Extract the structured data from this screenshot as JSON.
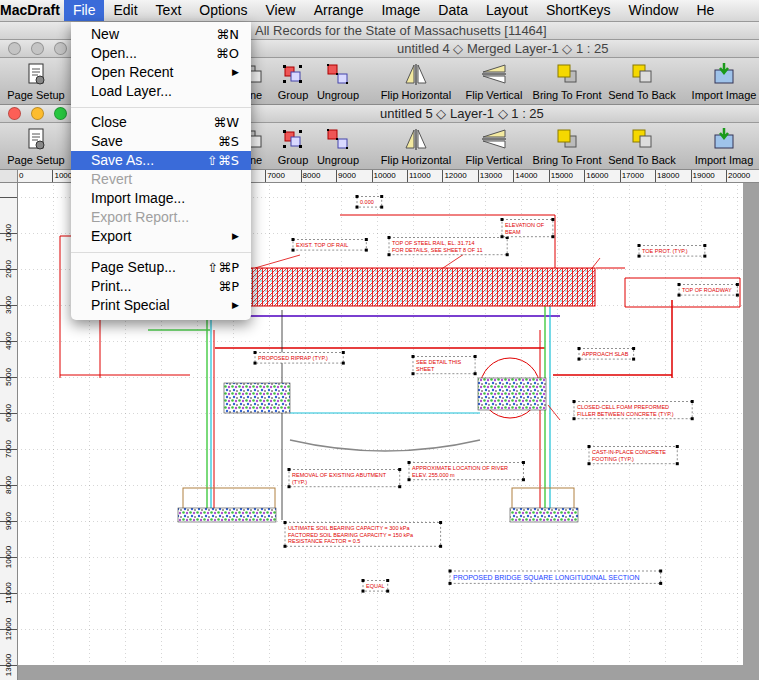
{
  "menubar": {
    "app": "MacDraft",
    "items": [
      {
        "label": "File",
        "selected": true
      },
      {
        "label": "Edit",
        "selected": false
      },
      {
        "label": "Text",
        "selected": false
      },
      {
        "label": "Options",
        "selected": false
      },
      {
        "label": "View",
        "selected": false
      },
      {
        "label": "Arrange",
        "selected": false
      },
      {
        "label": "Image",
        "selected": false
      },
      {
        "label": "Data",
        "selected": false
      },
      {
        "label": "Layout",
        "selected": false
      },
      {
        "label": "ShortKeys",
        "selected": false
      },
      {
        "label": "Window",
        "selected": false
      },
      {
        "label": "He",
        "selected": false
      }
    ]
  },
  "file_menu": [
    {
      "kind": "item",
      "label": "New",
      "shortcut": "⌘N",
      "selected": false,
      "disabled": false
    },
    {
      "kind": "item",
      "label": "Open...",
      "shortcut": "⌘O",
      "selected": false,
      "disabled": false
    },
    {
      "kind": "item",
      "label": "Open Recent",
      "shortcut": "▶",
      "selected": false,
      "disabled": false
    },
    {
      "kind": "item",
      "label": "Load Layer...",
      "shortcut": "",
      "selected": false,
      "disabled": false
    },
    {
      "kind": "separator"
    },
    {
      "kind": "item",
      "label": "Close",
      "shortcut": "⌘W",
      "selected": false,
      "disabled": false
    },
    {
      "kind": "item",
      "label": "Save",
      "shortcut": "⌘S",
      "selected": false,
      "disabled": false
    },
    {
      "kind": "item",
      "label": "Save As...",
      "shortcut": "⇧⌘S",
      "selected": true,
      "disabled": false
    },
    {
      "kind": "item",
      "label": "Revert",
      "shortcut": "",
      "selected": false,
      "disabled": true
    },
    {
      "kind": "item",
      "label": "Import Image...",
      "shortcut": "",
      "selected": false,
      "disabled": false
    },
    {
      "kind": "item",
      "label": "Export Report...",
      "shortcut": "",
      "selected": false,
      "disabled": true
    },
    {
      "kind": "item",
      "label": "Export",
      "shortcut": "▶",
      "selected": false,
      "disabled": false
    },
    {
      "kind": "separator"
    },
    {
      "kind": "item",
      "label": "Page Setup...",
      "shortcut": "⇧⌘P",
      "selected": false,
      "disabled": false
    },
    {
      "kind": "item",
      "label": "Print...",
      "shortcut": "⌘P",
      "selected": false,
      "disabled": false
    },
    {
      "kind": "item",
      "label": "Print Special",
      "shortcut": "▶",
      "selected": false,
      "disabled": false
    }
  ],
  "background_window": {
    "title": "All Records for the State of Massachusetts [11464]"
  },
  "windows": [
    {
      "title": "untitled 4 ◇ Merged Layer-1 ◇ 1 : 25",
      "active": false,
      "toolbar": [
        "Page Setup",
        "one",
        "Group",
        "Ungroup",
        "Flip Horizontal",
        "Flip Vertical",
        "Bring To Front",
        "Send To Back",
        "Import Image"
      ]
    },
    {
      "title": "untitled 5 ◇ Layer-1 ◇ 1 : 25",
      "active": true,
      "toolbar": [
        "Page Setup",
        "one",
        "Group",
        "Ungroup",
        "Flip Horizontal",
        "Flip Vertical",
        "Bring To Front",
        "Send To Back",
        "Import Imag"
      ]
    }
  ],
  "rulers": {
    "horizontal": [
      "0",
      "1000",
      "7000",
      "8000",
      "9000",
      "10000",
      "11000",
      "12000",
      "13000",
      "14000",
      "15000",
      "16000",
      "17000",
      "18000",
      "19000",
      "20000"
    ],
    "vertical": [
      "1000",
      "2000",
      "3000",
      "4000",
      "5000",
      "6000",
      "7000",
      "8000",
      "9000",
      "10000",
      "11000",
      "12000",
      "13000"
    ]
  },
  "drawing": {
    "title": "PROPOSED BRIDGE SQUARE LONGITUDINAL SECTION",
    "labels": [
      {
        "lines": [
          "0.000"
        ]
      },
      {
        "lines": [
          "TOP OF STEEL RAIL, EL. 31.714",
          "FOR DETAILS, SEE SHEET 8 OF 11"
        ]
      },
      {
        "lines": [
          "EXIST. TOP OF RAIL"
        ]
      },
      {
        "lines": [
          "ELEVATION OF",
          "BEAM"
        ]
      },
      {
        "lines": [
          "TOE PROT. (TYP.)"
        ]
      },
      {
        "lines": [
          "TOP OF ROADWAY"
        ]
      },
      {
        "lines": [
          "PROPOSED RIPRAP (TYP.)"
        ]
      },
      {
        "lines": [
          "SEE DETAIL THIS",
          "SHEET"
        ]
      },
      {
        "lines": [
          "APPROACH SLAB"
        ]
      },
      {
        "lines": [
          "CLOSED-CELL FOAM PREFORMED",
          "FILLER BETWEEN CONCRETE (TYP.)"
        ]
      },
      {
        "lines": [
          "CAST-IN-PLACE CONCRETE",
          "FOOTING (TYP.)"
        ]
      },
      {
        "lines": [
          "REMOVAL OF EXISTING ABUTMENT",
          "(TYP.)"
        ]
      },
      {
        "lines": [
          "APPROXIMATE LOCATION OF RIVER",
          "ELEV. 255.000 m"
        ]
      },
      {
        "lines": [
          "ULTIMATE SOIL BEARING CAPACITY = 300 kPa",
          "FACTORED SOIL BEARING CAPACITY = 150 kPa",
          "RESISTANCE FACTOR = 0.5"
        ]
      },
      {
        "lines": [
          "EQUAL"
        ]
      }
    ]
  }
}
